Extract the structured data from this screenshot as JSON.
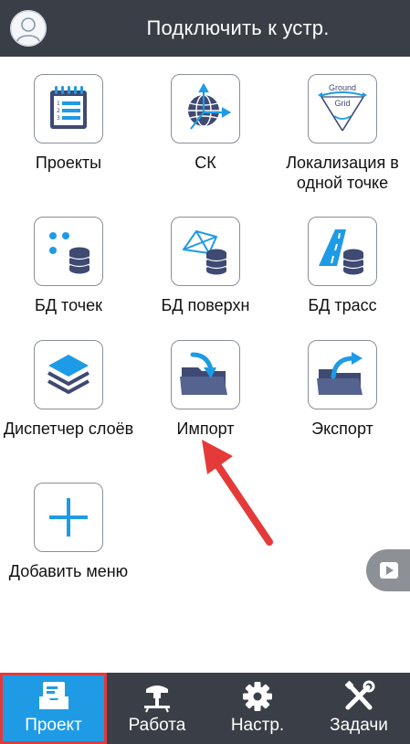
{
  "header": {
    "title": "Подключить к устр."
  },
  "tiles": [
    {
      "label": "Проекты",
      "icon": "projects-icon"
    },
    {
      "label": "СК",
      "icon": "coordinate-system-icon"
    },
    {
      "label": "Локализация в одной точке",
      "icon": "localization-icon"
    },
    {
      "label": "БД точек",
      "icon": "points-db-icon"
    },
    {
      "label": "БД поверхн",
      "icon": "surface-db-icon"
    },
    {
      "label": "БД трасс",
      "icon": "road-db-icon"
    },
    {
      "label": "Диспетчер слоёв",
      "icon": "layers-icon"
    },
    {
      "label": "Импорт",
      "icon": "import-icon"
    },
    {
      "label": "Экспорт",
      "icon": "export-icon"
    },
    {
      "label": "Добавить меню",
      "icon": "plus-icon"
    }
  ],
  "localization_icon_text": {
    "top": "Ground",
    "bottom": "Grid"
  },
  "nav": {
    "items": [
      {
        "label": "Проект",
        "icon": "project-tray-icon",
        "active": true
      },
      {
        "label": "Работа",
        "icon": "gnss-receiver-icon",
        "active": false
      },
      {
        "label": "Настр.",
        "icon": "gear-icon",
        "active": false
      },
      {
        "label": "Задачи",
        "icon": "tools-icon",
        "active": false
      }
    ]
  },
  "colors": {
    "header_bg": "#3a3f47",
    "accent_blue": "#1e9be6",
    "icon_dark": "#3e4a72",
    "arrow_red": "#e53a3a",
    "active_outline": "#e23a3a"
  }
}
